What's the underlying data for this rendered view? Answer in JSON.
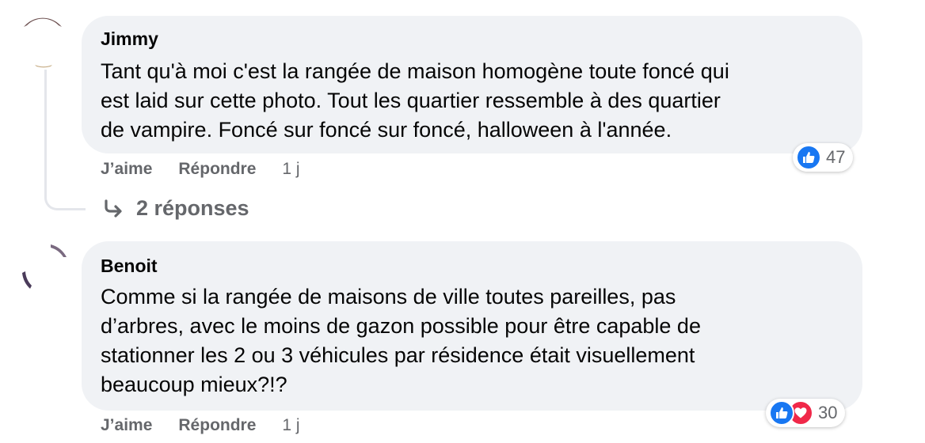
{
  "comments": [
    {
      "author": "Jimmy",
      "author_tail": "",
      "lines": [
        "Tant qu'à moi c'est la rangée de maison homogène toute foncé qui",
        "est laid sur cette photo. Tout les quartier ressemble à des quartier",
        "de vampire. Foncé sur foncé sur foncé, halloween à l'année."
      ],
      "like_label": "J’aime",
      "reply_label": "Répondre",
      "time": "1 j",
      "reaction_count": "47",
      "reactions": [
        "like-icon"
      ]
    },
    {
      "author": "Benoit",
      "author_tail": "",
      "lines": [
        "Comme si la rangée de maisons de ville toutes pareilles, pas",
        "d’arbres, avec le moins de gazon possible pour être capable de",
        "stationner les 2 ou 3 véhicules par résidence était visuellement",
        "beaucoup mieux?!?"
      ],
      "like_label": "J’aime",
      "reply_label": "Répondre",
      "time": "1 j",
      "reaction_count": "30",
      "reactions": [
        "like-icon",
        "love-icon"
      ]
    }
  ],
  "replies_label": "2 réponses",
  "colors": {
    "bubble": "#f0f2f5",
    "meta_text": "#65676b",
    "like_blue": "#1877f2",
    "love_red": "#f02849"
  }
}
